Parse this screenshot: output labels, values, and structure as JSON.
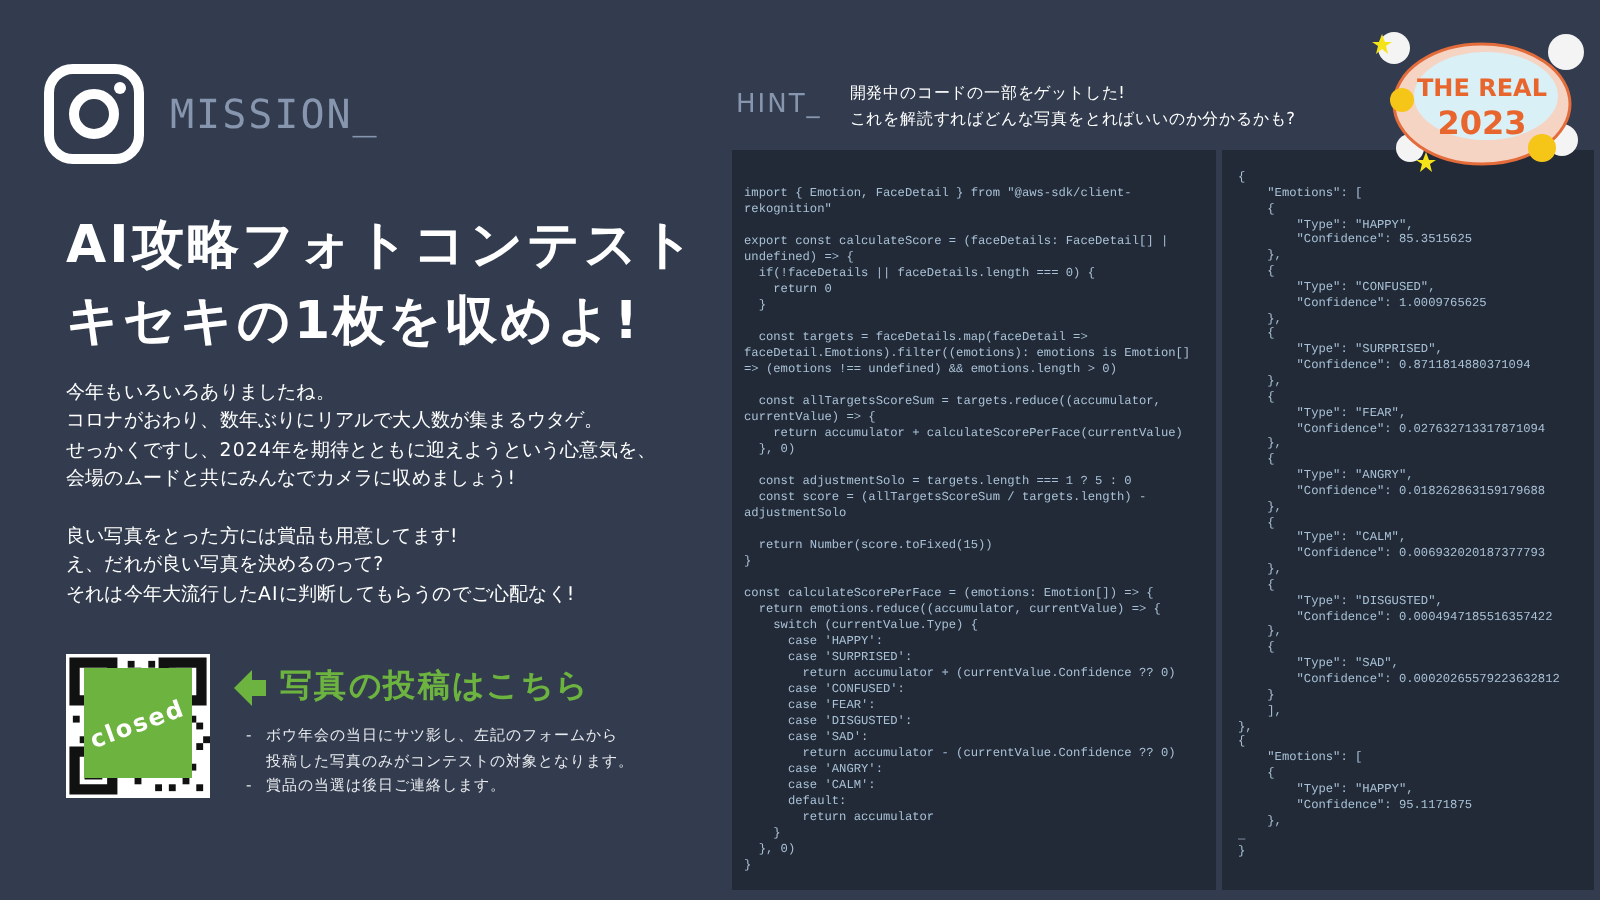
{
  "mission": {
    "label": "MISSION_"
  },
  "title": {
    "lines": [
      "AI攻略フォトコンテスト",
      "キセキの1枚を収めよ!"
    ]
  },
  "intro": {
    "paragraphs": [
      [
        "今年もいろいろありましたね。",
        "コロナがおわり、数年ぶりにリアルで大人数が集まるウタゲ。",
        "せっかくですし、2024年を期待とともに迎えようという心意気を、",
        "会場のムードと共にみんなでカメラに収めましょう!"
      ],
      [
        "良い写真をとった方には賞品も用意してます!",
        "え、だれが良い写真を決めるのって?",
        "それは今年大流行したAIに判断してもらうのでご心配なく!"
      ]
    ]
  },
  "submission": {
    "qr_overlay": "closed",
    "heading": "写真の投稿はこちら",
    "bullets": [
      {
        "marker": "-",
        "lines": [
          "ボウ年会の当日にサツ影し、左記のフォームから",
          "投稿した写真のみがコンテストの対象となります。"
        ]
      },
      {
        "marker": "-",
        "lines": [
          "賞品の当選は後日ご連絡します。"
        ]
      }
    ]
  },
  "hint": {
    "label": "HINT_",
    "lines": [
      "開発中のコードの一部をゲットした!",
      "これを解読すればどんな写真をとればいいのか分かるかも?"
    ]
  },
  "logo": {
    "title": "THE REAL",
    "year": "2023"
  },
  "code": {
    "blocks": [
      [
        "import { Emotion, FaceDetail } from \"@aws-sdk/client-",
        "rekognition\""
      ],
      [
        "export const calculateScore = (faceDetails: FaceDetail[] |",
        "undefined) => {",
        "  if(!faceDetails || faceDetails.length === 0) {",
        "    return 0",
        "  }"
      ],
      [
        "  const targets = faceDetails.map(faceDetail =>",
        "faceDetail.Emotions).filter((emotions): emotions is Emotion[]",
        "=> (emotions !== undefined) && emotions.length > 0)"
      ],
      [
        "  const allTargetsScoreSum = targets.reduce((accumulator,",
        "currentValue) => {",
        "    return accumulator + calculateScorePerFace(currentValue)",
        "  }, 0)"
      ],
      [
        "  const adjustmentSolo = targets.length === 1 ? 5 : 0",
        "  const score = (allTargetsScoreSum / targets.length) -",
        "adjustmentSolo"
      ],
      [
        "  return Number(score.toFixed(15))",
        "}"
      ],
      [
        "const calculateScorePerFace = (emotions: Emotion[]) => {",
        "  return emotions.reduce((accumulator, currentValue) => {",
        "    switch (currentValue.Type) {",
        "      case 'HAPPY':",
        "      case 'SURPRISED':",
        "        return accumulator + (currentValue.Confidence ?? 0)",
        "      case 'CONFUSED':",
        "      case 'FEAR':",
        "      case 'DISGUSTED':",
        "      case 'SAD':",
        "        return accumulator - (currentValue.Confidence ?? 0)",
        "      case 'ANGRY':",
        "      case 'CALM':",
        "      default:",
        "        return accumulator",
        "    }",
        "  }, 0)",
        "}"
      ]
    ]
  },
  "json_output": {
    "lines": [
      "{",
      "    \"Emotions\": [",
      "    {",
      "        \"Type\": \"HAPPY\",",
      "        \"Confidence\": 85.3515625",
      "    },",
      "    {",
      "        \"Type\": \"CONFUSED\",",
      "        \"Confidence\": 1.0009765625",
      "    },",
      "    {",
      "        \"Type\": \"SURPRISED\",",
      "        \"Confidence\": 0.8711814880371094",
      "    },",
      "    {",
      "        \"Type\": \"FEAR\",",
      "        \"Confidence\": 0.027632713317871094",
      "    },",
      "    {",
      "        \"Type\": \"ANGRY\",",
      "        \"Confidence\": 0.018262863159179688",
      "    },",
      "    {",
      "        \"Type\": \"CALM\",",
      "        \"Confidence\": 0.006932020187377793",
      "    },",
      "    {",
      "        \"Type\": \"DISGUSTED\",",
      "        \"Confidence\": 0.0004947185516357422",
      "    },",
      "    {",
      "        \"Type\": \"SAD\",",
      "        \"Confidence\": 0.00020265579223632812",
      "    }",
      "    ],",
      "},",
      "{",
      "    \"Emotions\": [",
      "    {",
      "        \"Type\": \"HAPPY\",",
      "        \"Confidence\": 95.1171875",
      "    },",
      "_",
      "}"
    ]
  }
}
